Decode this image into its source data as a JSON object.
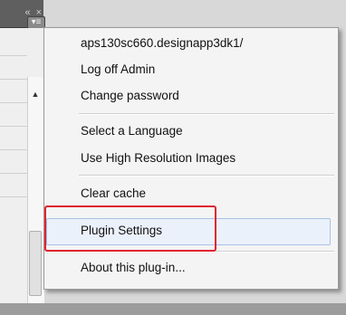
{
  "panel": {
    "collapse_glyph": "«",
    "close_glyph": "×",
    "menu_glyph": "▾≡",
    "scroll_up_glyph": "▲"
  },
  "menu": {
    "items": [
      {
        "label": "aps130sc660.designapp3dk1/"
      },
      {
        "label": "Log off Admin"
      },
      {
        "label": "Change password"
      },
      {
        "label": "Select a Language"
      },
      {
        "label": "Use High Resolution Images"
      },
      {
        "label": "Clear cache"
      },
      {
        "label": "Plugin Settings",
        "hovered": true,
        "highlighted": true
      },
      {
        "label": "About this plug-in..."
      }
    ]
  },
  "colors": {
    "highlight_box": "#e0242f",
    "hover_bg": "#ebf1fb",
    "hover_border": "#a8c0e6"
  }
}
